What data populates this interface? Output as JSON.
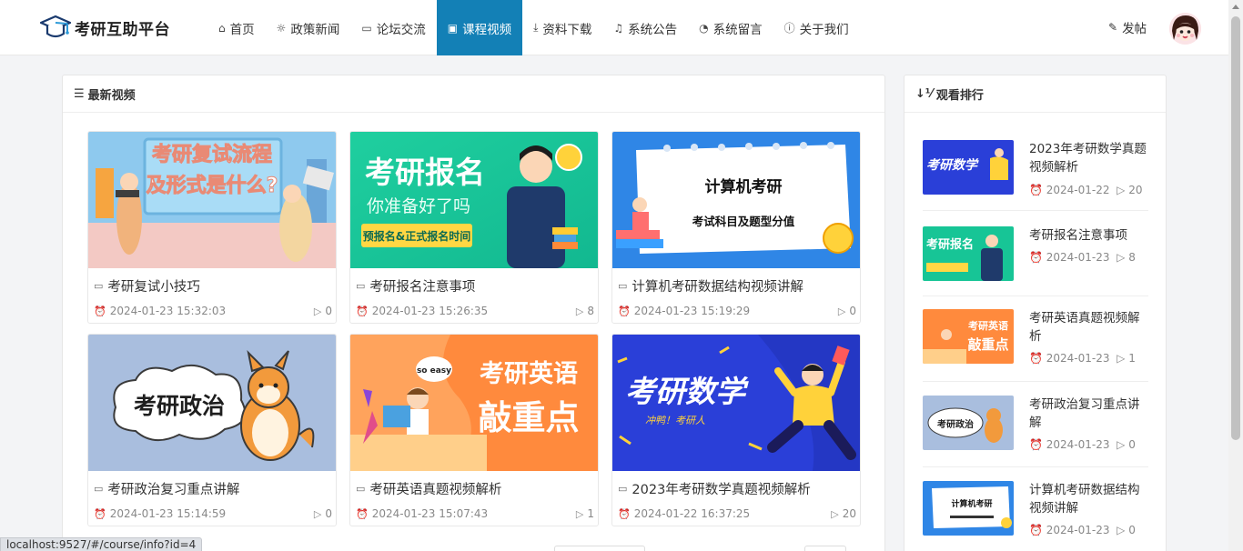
{
  "brand": {
    "name": "考研互助平台"
  },
  "nav": {
    "items": [
      {
        "icon": "⌂",
        "label": "首页",
        "active": false,
        "name": "home"
      },
      {
        "icon": "☼",
        "label": "政策新闻",
        "active": false,
        "name": "policy-news"
      },
      {
        "icon": "▭",
        "label": "论坛交流",
        "active": false,
        "name": "forum"
      },
      {
        "icon": "▣",
        "label": "课程视频",
        "active": true,
        "name": "course-videos"
      },
      {
        "icon": "⤓",
        "label": "资料下载",
        "active": false,
        "name": "downloads"
      },
      {
        "icon": "♫",
        "label": "系统公告",
        "active": false,
        "name": "announcements"
      },
      {
        "icon": "◔",
        "label": "系统留言",
        "active": false,
        "name": "messages"
      },
      {
        "icon": "ⓘ",
        "label": "关于我们",
        "active": false,
        "name": "about-us"
      }
    ],
    "post_label": "发帖"
  },
  "latest": {
    "title": "最新视频",
    "videos": [
      {
        "title": "考研复试小技巧",
        "time": "2024-01-23 15:32:03",
        "views": "0",
        "thumb": "复试"
      },
      {
        "title": "考研报名注意事项",
        "time": "2024-01-23 15:26:35",
        "views": "8",
        "thumb": "报名"
      },
      {
        "title": "计算机考研数据结构视频讲解",
        "time": "2024-01-23 15:19:29",
        "views": "0",
        "thumb": "计算机"
      },
      {
        "title": "考研政治复习重点讲解",
        "time": "2024-01-23 15:14:59",
        "views": "0",
        "thumb": "政治"
      },
      {
        "title": "考研英语真题视频解析",
        "time": "2024-01-23 15:07:43",
        "views": "1",
        "thumb": "英语"
      },
      {
        "title": "2023年考研数学真题视频解析",
        "time": "2024-01-22 16:37:25",
        "views": "20",
        "thumb": "数学"
      }
    ],
    "thumb_text": {
      "fushi": [
        "考研复试流程",
        "及形式是什么?"
      ],
      "baoming": [
        "考研报名",
        "你准备好了吗",
        "预报名&正式报名时间"
      ],
      "jisuanji": [
        "计算机考研",
        "考试科目及题型分值"
      ],
      "zhengzhi": [
        "考研政治"
      ],
      "yingyu": [
        "考研英语",
        "敲重点",
        "so easy"
      ],
      "shuxue": [
        "考研数学",
        "冲鸭！考研人"
      ]
    }
  },
  "ranking": {
    "title": "观看排行",
    "items": [
      {
        "title": "2023年考研数学真题视频解析",
        "date": "2024-01-22",
        "views": "20"
      },
      {
        "title": "考研报名注意事项",
        "date": "2024-01-23",
        "views": "8"
      },
      {
        "title": "考研英语真题视频解析",
        "date": "2024-01-23",
        "views": "1"
      },
      {
        "title": "考研政治复习重点讲解",
        "date": "2024-01-23",
        "views": "0"
      },
      {
        "title": "计算机考研数据结构视频讲解",
        "date": "2024-01-23",
        "views": "0"
      }
    ],
    "thumb_text": {
      "shuxue": "考研数学",
      "baoming": "考研报名",
      "yingyu": [
        "考研英语",
        "敲重点"
      ],
      "zhengzhi": "考研政治",
      "jisuanji": "计算机考研"
    }
  },
  "status_bar": {
    "url": "localhost:9527/#/course/info?id=4"
  },
  "colors": {
    "accent": "#1380b6",
    "page_bg": "#f3f4f6"
  }
}
